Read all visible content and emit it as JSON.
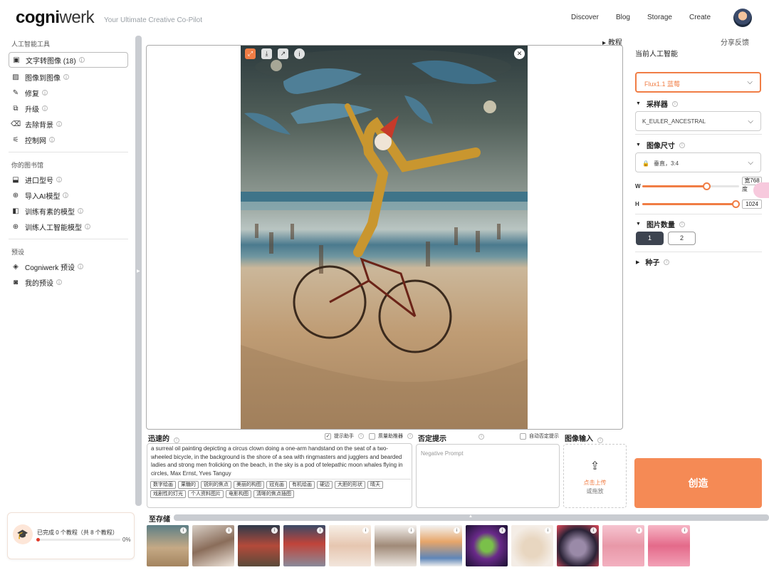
{
  "header": {
    "logo_bold": "cogni",
    "logo_thin": "werk",
    "tagline": "Your Ultimate Creative Co-Pilot",
    "nav": [
      "Discover",
      "Blog",
      "Storage",
      "Create"
    ]
  },
  "sidebar": {
    "section_ai_tools": "人工智能工具",
    "ai_tools": [
      {
        "label": "文字转图像 (18)",
        "icon": "text-to-image-icon"
      },
      {
        "label": "图像到图像",
        "icon": "image-icon"
      },
      {
        "label": "修复",
        "icon": "brush-icon"
      },
      {
        "label": "升级",
        "icon": "upscale-icon"
      },
      {
        "label": "去除背景",
        "icon": "eraser-icon"
      },
      {
        "label": "控制网",
        "icon": "sliders-icon"
      }
    ],
    "section_library": "你的图书馆",
    "library": [
      {
        "label": "进口型号",
        "icon": "import-icon"
      },
      {
        "label": "导入AI模型",
        "icon": "plus-circle-icon"
      },
      {
        "label": "训练有素的模型",
        "icon": "trained-model-icon"
      },
      {
        "label": "训练人工智能模型",
        "icon": "plus-circle-icon"
      }
    ],
    "section_presets": "预设",
    "presets": [
      {
        "label": "Cogniwerk 预设",
        "icon": "preset-icon"
      },
      {
        "label": "我的预设",
        "icon": "user-preset-icon"
      }
    ]
  },
  "tutorial_card": {
    "text": "已完成 0 个教程（共 8 个教程）",
    "percent": "0%",
    "progress": 0
  },
  "top_links": {
    "tutorial": "教程",
    "feedback": "分享反馈"
  },
  "prompt": {
    "label": "迅速的",
    "assist_label": "提示助手",
    "quality_label": "质量助推器",
    "text": "a surreal oil painting depicting a circus clown doing a one-arm handstand on the seat of a two-wheeled bicycle, in the background is the shore of a sea with ringmasters and jugglers and bearded ladies and strong men frolicking on the beach, in the sky is a pod of telepathic moon whales flying in circles, Max Ernst, Yves Tanguy",
    "chips": [
      "数字绘画",
      "果糖的",
      "锐利的焦点",
      "美丽的构图",
      "冠充画",
      "有机绘画",
      "硬边",
      "大胆的形状",
      "晴天",
      "戏剧性的灯光",
      "个人资料图片",
      "电影构图",
      "清晰的焦点插图"
    ]
  },
  "negative": {
    "label": "否定提示",
    "auto_label": "自动否定提示",
    "placeholder": "Negative Prompt"
  },
  "image_input": {
    "label": "图像输入",
    "upload_main": "点击上传",
    "upload_sub": "或拖放"
  },
  "right_panel": {
    "current_model_label": "当前人工智能",
    "model_value": "Flux1.1 蓝莓",
    "sampler_label": "采样器",
    "sampler_value": "K_EULER_ANCESTRAL",
    "size_label": "图像尺寸",
    "size_value": "垂直，3:4",
    "w_label": "W",
    "w_value": "768",
    "w_fraction": 0.66,
    "w_overlay": "宽",
    "w_overlay2": "度",
    "h_label": "H",
    "h_value": "1024",
    "h_fraction": 1.0,
    "count_label": "图片数量",
    "count_options": [
      "1",
      "2"
    ],
    "count_selected": "1",
    "seed_label": "种子",
    "create_label": "创造"
  },
  "storage": {
    "label": "至存储"
  },
  "colors": {
    "accent": "#f07d45",
    "create_button": "#f58a55",
    "dark_button": "#3d4450"
  }
}
